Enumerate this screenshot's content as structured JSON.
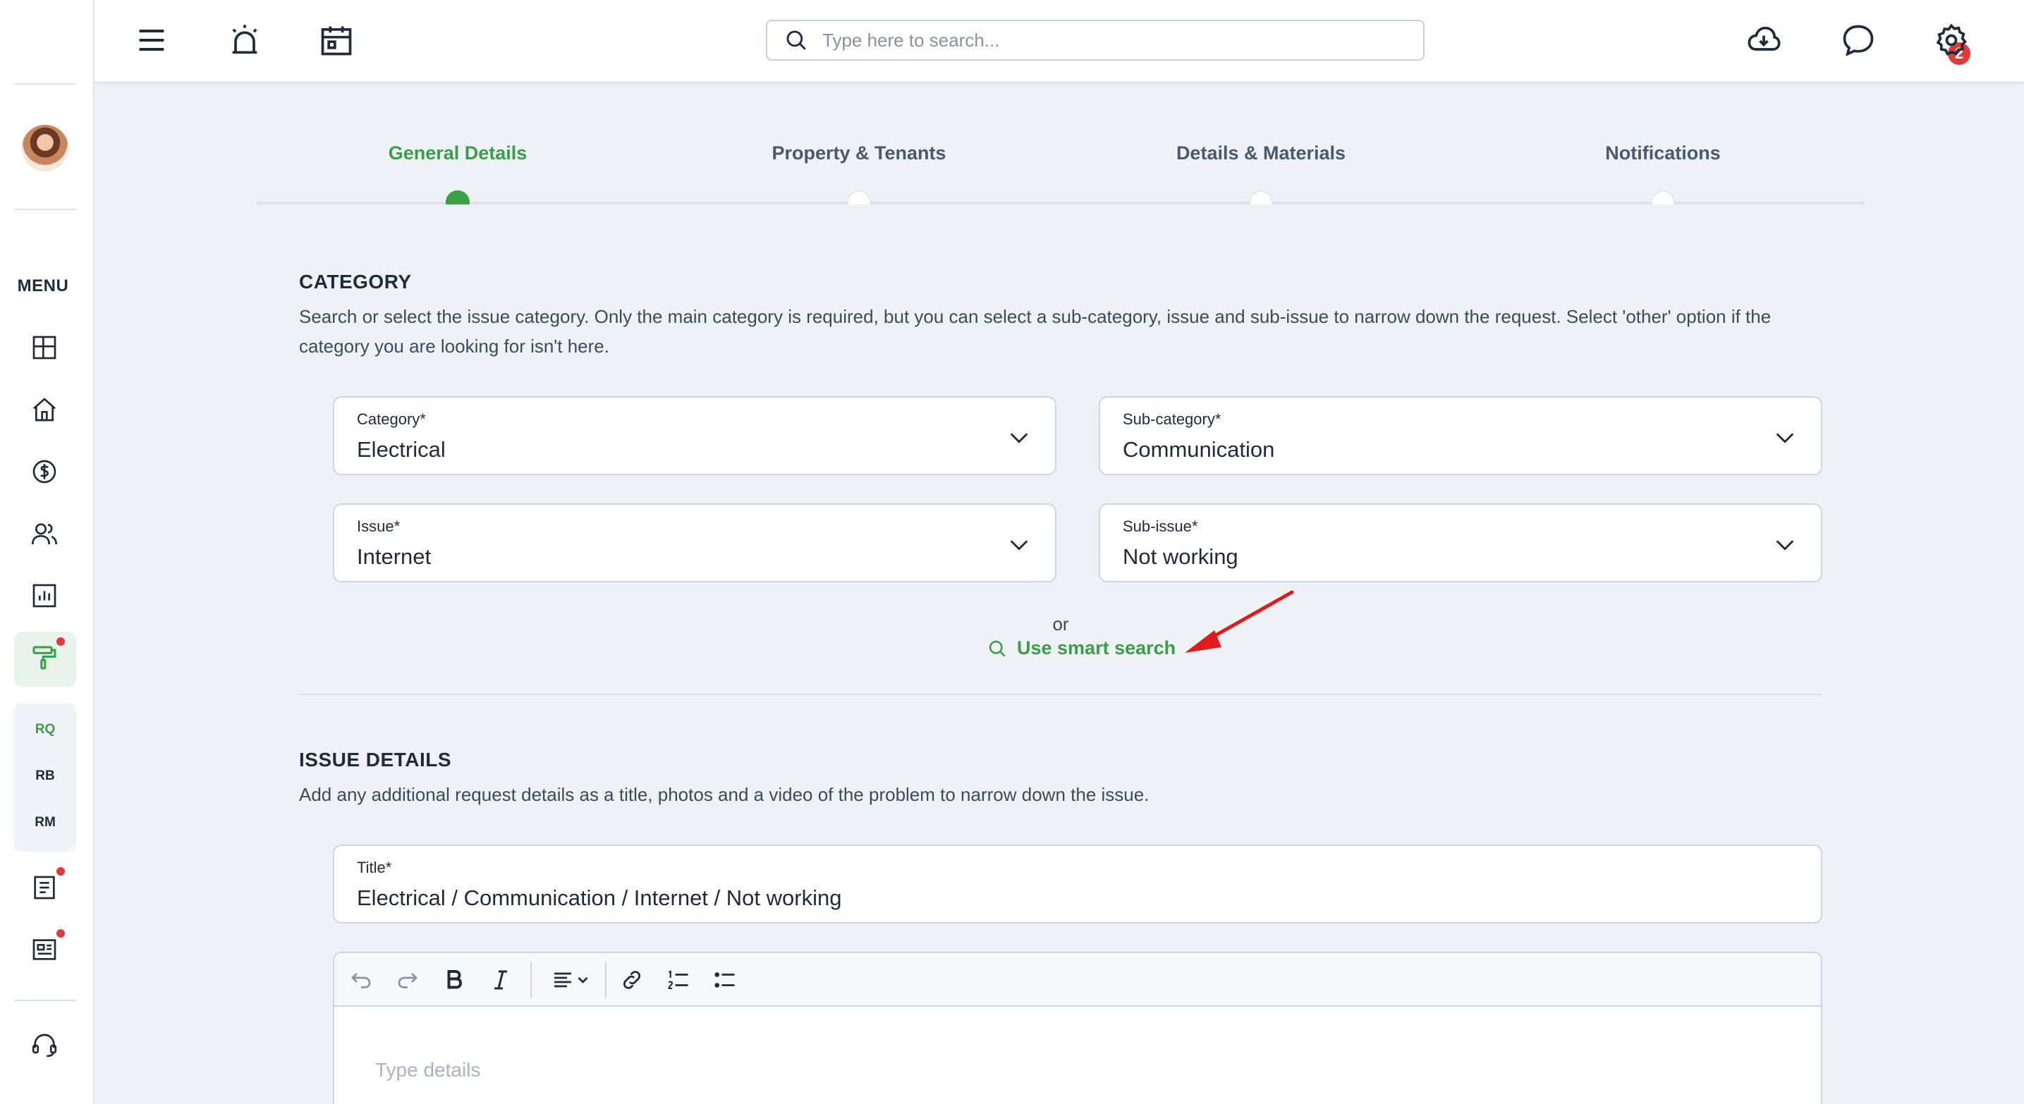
{
  "sidebar": {
    "menu_label": "MENU",
    "sub_items": [
      "RQ",
      "RB",
      "RM"
    ]
  },
  "topbar": {
    "search_placeholder": "Type here to search...",
    "notification_count": "2"
  },
  "stepper": {
    "steps": [
      "General Details",
      "Property & Tenants",
      "Details & Materials",
      "Notifications"
    ],
    "active_index": 0
  },
  "category": {
    "title": "CATEGORY",
    "description": "Search or select the issue category. Only the main category is required, but you can select a sub-category, issue and sub-issue to narrow down the request. Select 'other' option if the category you are looking for isn't here.",
    "fields": {
      "category": {
        "label": "Category*",
        "value": "Electrical"
      },
      "sub_category": {
        "label": "Sub-category*",
        "value": "Communication"
      },
      "issue": {
        "label": "Issue*",
        "value": "Internet"
      },
      "sub_issue": {
        "label": "Sub-issue*",
        "value": "Not working"
      }
    },
    "or_text": "or",
    "smart_search_label": "Use smart search"
  },
  "issue_details": {
    "title": "ISSUE DETAILS",
    "description": "Add any additional request details as a title, photos and a video of the problem to narrow down the issue.",
    "title_field": {
      "label": "Title*",
      "value": "Electrical / Communication / Internet / Not working"
    },
    "editor_placeholder": "Type details"
  },
  "colors": {
    "accent_green": "#3a9d47",
    "alert_red": "#e03a3a",
    "annotation_arrow": "#e01b1b"
  }
}
